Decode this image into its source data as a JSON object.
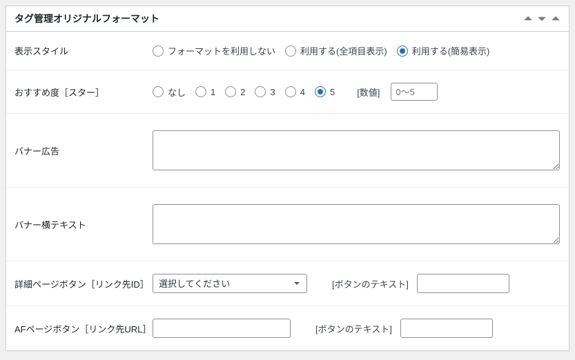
{
  "panel": {
    "title": "タグ管理オリジナルフォーマット"
  },
  "rows": {
    "display_style": {
      "label": "表示スタイル",
      "options": {
        "none": "フォーマットを利用しない",
        "full": "利用する(全項目表示)",
        "simple": "利用する(簡易表示)"
      },
      "selected": "simple"
    },
    "recommend": {
      "label": "おすすめ度［スター］",
      "options": {
        "none": "なし",
        "v1": "1",
        "v2": "2",
        "v3": "3",
        "v4": "4",
        "v5": "5"
      },
      "selected": "v5",
      "num_label": "[数値]",
      "num_placeholder": "0～5"
    },
    "banner_ad": {
      "label": "バナー広告",
      "value": ""
    },
    "banner_text": {
      "label": "バナー横テキスト",
      "value": ""
    },
    "detail_btn": {
      "label": "詳細ページボタン［リンク先ID］",
      "select_placeholder": "選択してください",
      "btntext_label": "[ボタンのテキスト]",
      "btntext_value": ""
    },
    "af_btn": {
      "label": "AFページボタン［リンク先URL］",
      "url_value": "",
      "btntext_label": "[ボタンのテキスト]",
      "btntext_value": ""
    }
  }
}
